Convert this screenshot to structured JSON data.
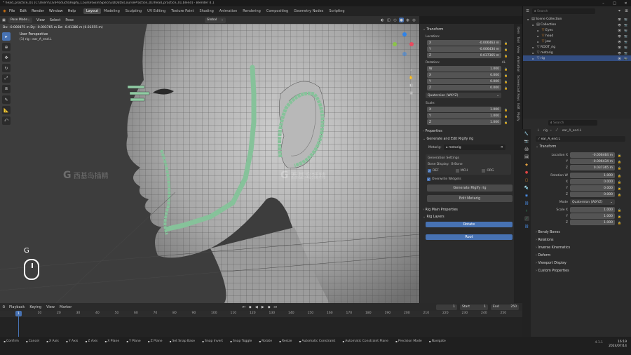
{
  "app": {
    "title": "* head_practice_01 [C:\\Users\\CG\\Products\\Rigify_Course\\Skin\\Specs\\3DData\\CoursePractice_01\\head_practice_01.blend] - Blender 4.1",
    "menus": [
      "File",
      "Edit",
      "Render",
      "Window",
      "Help"
    ],
    "workspaces": [
      "Layout",
      "Modeling",
      "Sculpting",
      "UV Editing",
      "Texture Paint",
      "Shading",
      "Animation",
      "Rendering",
      "Compositing",
      "Geometry Nodes",
      "Scripting"
    ],
    "active_workspace": "Layout",
    "scene": "Scene",
    "view_layer": "ViewLayer"
  },
  "viewport": {
    "mode": "Pose Mode",
    "header_menus": [
      "View",
      "Select",
      "Pose"
    ],
    "transform_orientation": "Global",
    "perspective": "User Perspective",
    "object_label": "(1) rig : ear_A_end.L",
    "delta_readout": "Dx: -0.000875 m  Dy: -0.003765 m  Dz: -0.01386 m (0.01555 m)",
    "key_hint": "G",
    "watermark": "西基岛插精"
  },
  "npanel": {
    "transform_title": "Transform",
    "location_label": "Location:",
    "location": [
      {
        "axis": "X",
        "value": "-0.006463 m"
      },
      {
        "axis": "Y",
        "value": "-0.006434 m"
      },
      {
        "axis": "Z",
        "value": "0.037365 m"
      }
    ],
    "rotation_label": "Rotation:",
    "rotation_mode": "4L",
    "rotation": [
      {
        "axis": "W",
        "value": "1.000"
      },
      {
        "axis": "X",
        "value": "0.000"
      },
      {
        "axis": "Y",
        "value": "0.000"
      },
      {
        "axis": "Z",
        "value": "0.000"
      }
    ],
    "quaternion": "Quaternion (WXYZ)",
    "scale_label": "Scale:",
    "scale": [
      {
        "axis": "X",
        "value": "1.000"
      },
      {
        "axis": "Y",
        "value": "1.000"
      },
      {
        "axis": "Z",
        "value": "1.000"
      }
    ],
    "properties": "Properties",
    "generate_title": "Generate and Edit Rigify rig",
    "metarig_label": "Metarig:",
    "metarig_value": "metarig",
    "generation_settings": "Generation Settings",
    "bone_display_label": "Bone Display:",
    "bone_display_value": "B-Bone",
    "def": "DEF",
    "mch": "MCH",
    "org": "ORG",
    "overwrite": "Overwrite Widgets",
    "generate_btn": "Generate Rigify rig",
    "edit_btn": "Edit Metarig",
    "main_props": "Rig Main Properties",
    "rig_layers": "Rig Layers",
    "layer_btn1": "Rotate",
    "layer_btn2": "Root",
    "tabs": [
      "Item",
      "Tool",
      "View",
      "Animation",
      "Screencast Keys",
      "Edit",
      "Rigify"
    ]
  },
  "outliner": {
    "search_placeholder": "Search",
    "rows": [
      {
        "label": "Scene Collection",
        "indent": 0,
        "selected": false
      },
      {
        "label": "Collection",
        "indent": 1,
        "selected": false
      },
      {
        "label": "Eyes",
        "indent": 2,
        "selected": false
      },
      {
        "label": "head",
        "indent": 2,
        "selected": false
      },
      {
        "label": "jaw",
        "indent": 2,
        "selected": false
      },
      {
        "label": "ROOT_rig",
        "indent": 1,
        "selected": false
      },
      {
        "label": "metarig",
        "indent": 1,
        "selected": false
      },
      {
        "label": "rig",
        "indent": 1,
        "selected": true
      }
    ]
  },
  "props": {
    "search_placeholder": "Search",
    "breadcrumb_obj": "rig",
    "breadcrumb_bone": "ear_A_end.L",
    "bone_name": "ear_A_end.L",
    "transform_title": "Transform",
    "location_label": "Location X",
    "location": [
      "-0.006464 m",
      "-0.006434 m",
      "0.037365 m"
    ],
    "rotation_label": "Rotation W",
    "rotation": [
      "1.000",
      "0.000",
      "0.000",
      "0.000"
    ],
    "mode_label": "Mode",
    "mode_value": "Quaternion (WXYZ)",
    "scale_label": "Scale X",
    "scale": [
      "1.000",
      "1.000",
      "1.000"
    ],
    "axes": [
      "X",
      "Y",
      "Z",
      "W"
    ],
    "sections": [
      "Bendy Bones",
      "Relations",
      "Inverse Kinematics",
      "Deform",
      "Viewport Display",
      "Custom Properties"
    ]
  },
  "timeline": {
    "menus": [
      "Playback",
      "Keying",
      "View",
      "Marker"
    ],
    "current_frame": "1",
    "start_label": "Start",
    "start": "1",
    "end_label": "End",
    "end": "250",
    "ticks": [
      "1",
      "10",
      "20",
      "30",
      "40",
      "50",
      "60",
      "70",
      "80",
      "90",
      "100",
      "110",
      "120",
      "130",
      "140",
      "150",
      "160",
      "170",
      "180",
      "190",
      "200",
      "210",
      "220",
      "230",
      "240",
      "250"
    ]
  },
  "statusbar": {
    "items": [
      "Confirm",
      "Cancel",
      "X Axis",
      "Y Axis",
      "Z Axis",
      "X Plane",
      "Y Plane",
      "Z Plane",
      "Set Snap Base",
      "Snap Invert",
      "Snap Toggle",
      "Rotate",
      "Resize",
      "Automatic Constraint",
      "Automatic Constraint Plane",
      "Precision Mode",
      "Navigate"
    ],
    "time": "16:19",
    "date": "2024/07/14",
    "version": "4.1.1"
  }
}
